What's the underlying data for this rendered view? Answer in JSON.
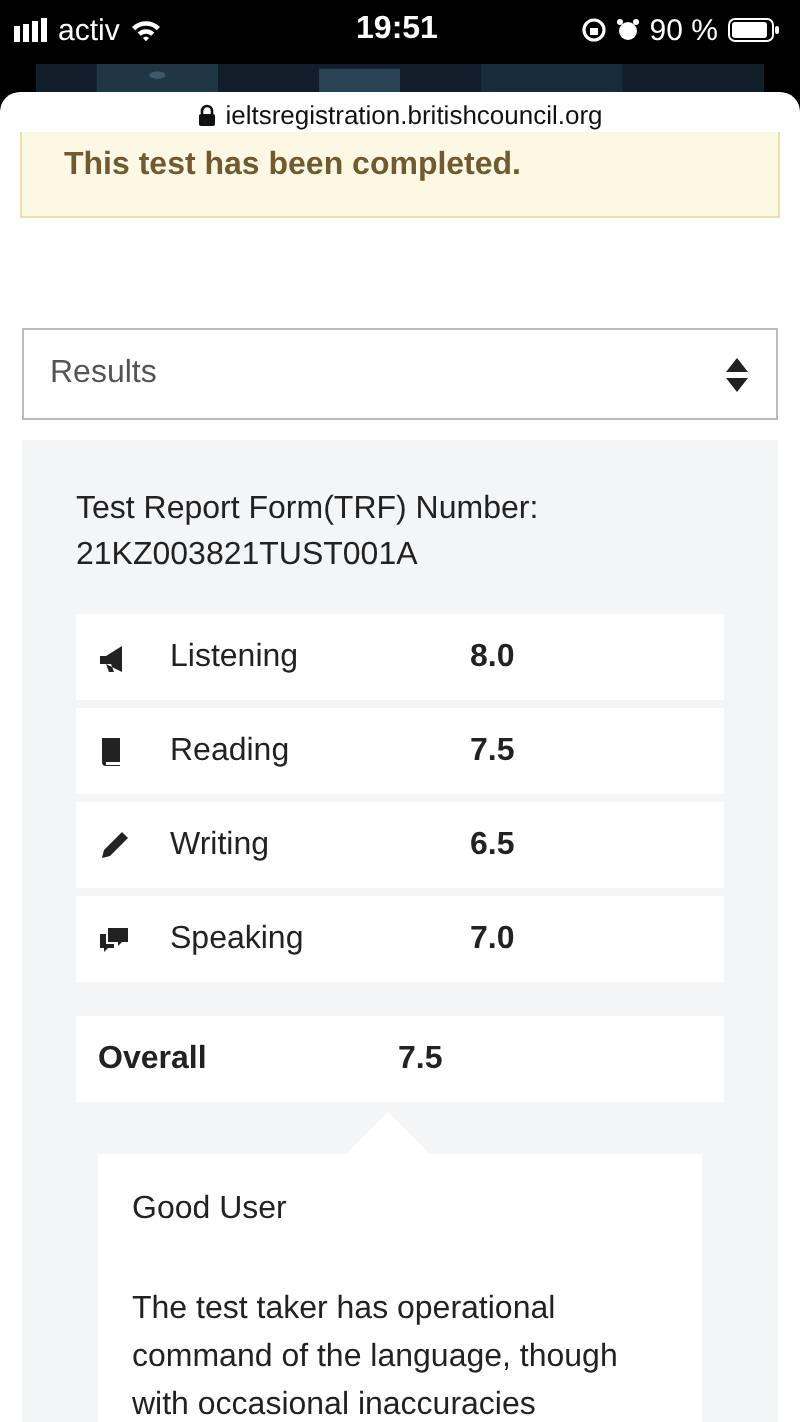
{
  "status_bar": {
    "carrier": "activ",
    "time": "19:51",
    "battery": "90 %"
  },
  "address_bar": {
    "url": "ieltsregistration.britishcouncil.org"
  },
  "alert": {
    "text": "This test has been completed."
  },
  "select": {
    "value": "Results"
  },
  "trf": {
    "label": "Test Report Form(TRF) Number:",
    "number": "21KZ003821TUST001A"
  },
  "scores": [
    {
      "skill": "Listening",
      "score": "8.0"
    },
    {
      "skill": "Reading",
      "score": "7.5"
    },
    {
      "skill": "Writing",
      "score": "6.5"
    },
    {
      "skill": "Speaking",
      "score": "7.0"
    }
  ],
  "overall": {
    "label": "Overall",
    "score": "7.5"
  },
  "band": {
    "title": "Good User",
    "description": "The test taker has operational command of the language, though with occasional inaccuracies"
  }
}
